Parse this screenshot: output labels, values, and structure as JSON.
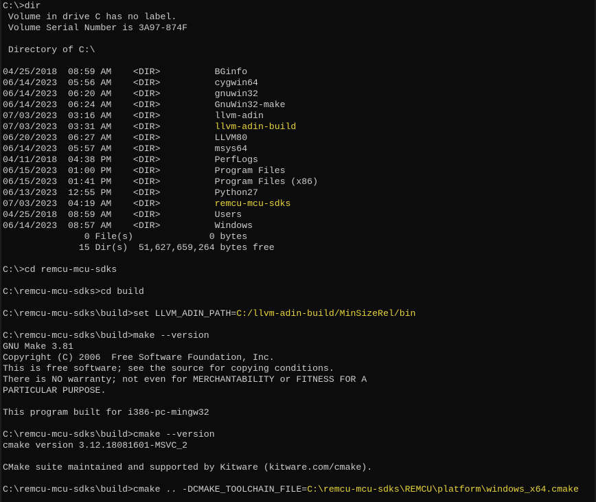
{
  "window": {
    "type": "Command Prompt",
    "colors": {
      "background": "#0c0c0c",
      "text": "#cccccc",
      "highlight": "#e7d43a"
    }
  },
  "lines": [
    {
      "text": "C:\\>dir"
    },
    {
      "text": " Volume in drive C has no label."
    },
    {
      "text": " Volume Serial Number is 3A97-874F"
    },
    {
      "text": ""
    },
    {
      "text": " Directory of C:\\"
    },
    {
      "text": ""
    },
    {
      "text": "04/25/2018  08:59 AM    <DIR>          BGinfo"
    },
    {
      "text": "06/14/2023  05:56 AM    <DIR>          cygwin64"
    },
    {
      "text": "06/14/2023  06:20 AM    <DIR>          gnuwin32"
    },
    {
      "text": "06/14/2023  06:24 AM    <DIR>          GnuWin32-make"
    },
    {
      "text": "07/03/2023  03:16 AM    <DIR>          llvm-adin"
    },
    {
      "prefix": "07/03/2023  03:31 AM    <DIR>          ",
      "hl": "llvm-adin-build"
    },
    {
      "text": "06/20/2023  06:27 AM    <DIR>          LLVM80"
    },
    {
      "text": "06/14/2023  05:57 AM    <DIR>          msys64"
    },
    {
      "text": "04/11/2018  04:38 PM    <DIR>          PerfLogs"
    },
    {
      "text": "06/15/2023  01:00 PM    <DIR>          Program Files"
    },
    {
      "text": "06/15/2023  01:41 PM    <DIR>          Program Files (x86)"
    },
    {
      "text": "06/13/2023  12:55 PM    <DIR>          Python27"
    },
    {
      "prefix": "07/03/2023  04:19 AM    <DIR>          ",
      "hl": "remcu-mcu-sdks"
    },
    {
      "text": "04/25/2018  08:59 AM    <DIR>          Users"
    },
    {
      "text": "06/14/2023  08:57 AM    <DIR>          Windows"
    },
    {
      "text": "               0 File(s)              0 bytes"
    },
    {
      "text": "              15 Dir(s)  51,627,659,264 bytes free"
    },
    {
      "text": ""
    },
    {
      "text": "C:\\>cd remcu-mcu-sdks"
    },
    {
      "text": ""
    },
    {
      "text": "C:\\remcu-mcu-sdks>cd build"
    },
    {
      "text": ""
    },
    {
      "prefix": "C:\\remcu-mcu-sdks\\build>set LLVM_ADIN_PATH=",
      "hl": "C:/llvm-adin-build/MinSizeRel/bin"
    },
    {
      "text": ""
    },
    {
      "text": "C:\\remcu-mcu-sdks\\build>make --version"
    },
    {
      "text": "GNU Make 3.81"
    },
    {
      "text": "Copyright (C) 2006  Free Software Foundation, Inc."
    },
    {
      "text": "This is free software; see the source for copying conditions."
    },
    {
      "text": "There is NO warranty; not even for MERCHANTABILITY or FITNESS FOR A"
    },
    {
      "text": "PARTICULAR PURPOSE."
    },
    {
      "text": ""
    },
    {
      "text": "This program built for i386-pc-mingw32"
    },
    {
      "text": ""
    },
    {
      "text": "C:\\remcu-mcu-sdks\\build>cmake --version"
    },
    {
      "text": "cmake version 3.12.18081601-MSVC_2"
    },
    {
      "text": ""
    },
    {
      "text": "CMake suite maintained and supported by Kitware (kitware.com/cmake)."
    },
    {
      "text": ""
    },
    {
      "prefix": "C:\\remcu-mcu-sdks\\build>cmake .. -DCMAKE_TOOLCHAIN_FILE=",
      "hl": "C:\\remcu-mcu-sdks\\REMCU\\platform\\windows_x64.cmake"
    }
  ]
}
